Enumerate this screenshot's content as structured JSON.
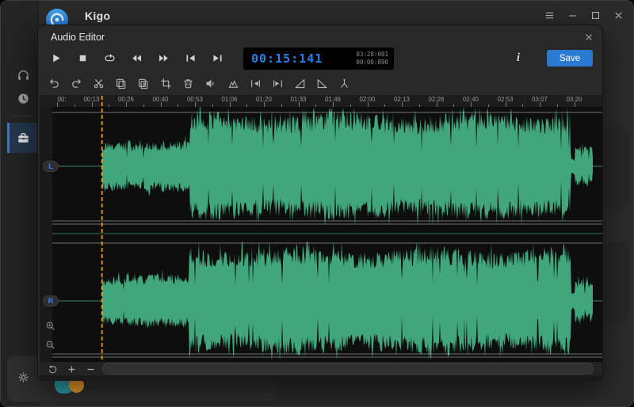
{
  "window": {
    "title": "Kigo",
    "controls": [
      {
        "icon": "menu-icon"
      },
      {
        "icon": "minimize-icon"
      },
      {
        "icon": "maximize-icon"
      },
      {
        "icon": "close-icon"
      }
    ]
  },
  "sidebar": {
    "items": [
      {
        "id": "audio",
        "icon": "headphones-icon",
        "active": false
      },
      {
        "id": "history",
        "icon": "history-icon",
        "active": false
      },
      {
        "id": "toolbox",
        "icon": "toolbox-icon",
        "active": true
      }
    ],
    "settings_icon": "gear-icon"
  },
  "dialog": {
    "title": "Audio Editor",
    "close_icon": "close-icon",
    "transport": [
      {
        "id": "play",
        "icon": "play-icon"
      },
      {
        "id": "stop",
        "icon": "stop-icon"
      },
      {
        "id": "loop",
        "icon": "loop-icon"
      },
      {
        "id": "rewind",
        "icon": "rewind-icon"
      },
      {
        "id": "fast-forward",
        "icon": "fast-forward-icon"
      },
      {
        "id": "skip-start",
        "icon": "skip-start-icon"
      },
      {
        "id": "skip-end",
        "icon": "skip-end-icon"
      }
    ],
    "time_display": {
      "current": "00:15:141",
      "total": "03:28:001",
      "remaining": "00:00:890"
    },
    "info_label": "i",
    "save_label": "Save",
    "toolbar": [
      {
        "id": "undo",
        "icon": "undo-icon"
      },
      {
        "id": "redo",
        "icon": "redo-icon"
      },
      {
        "id": "cut",
        "icon": "cut-icon"
      },
      {
        "id": "copy",
        "icon": "copy-icon"
      },
      {
        "id": "paste",
        "icon": "paste-icon"
      },
      {
        "id": "crop",
        "icon": "crop-icon"
      },
      {
        "id": "delete",
        "icon": "trash-icon"
      },
      {
        "id": "volume",
        "icon": "volume-icon"
      },
      {
        "id": "levels",
        "icon": "levels-icon"
      },
      {
        "id": "marker-in",
        "icon": "marker-in-icon"
      },
      {
        "id": "marker-out",
        "icon": "marker-out-icon"
      },
      {
        "id": "fade-in",
        "icon": "fade-in-icon"
      },
      {
        "id": "fade-out",
        "icon": "fade-out-icon"
      },
      {
        "id": "split",
        "icon": "split-icon"
      }
    ],
    "ruler_labels": [
      "00:",
      "00:13",
      "00:26",
      "00:40",
      "00:53",
      "01:06",
      "01:20",
      "01:33",
      "01:46",
      "02:00",
      "02:13",
      "02:26",
      "02:40",
      "02:53",
      "03:07",
      "03:20"
    ],
    "channels": [
      {
        "label": "L"
      },
      {
        "label": "R"
      }
    ],
    "zoom_controls": [
      {
        "id": "zoom-in",
        "icon": "zoom-in-icon"
      },
      {
        "id": "zoom-out",
        "icon": "zoom-out-icon"
      }
    ],
    "bottom_controls": [
      {
        "id": "reset-zoom",
        "icon": "reset-icon"
      },
      {
        "id": "increase",
        "icon": "plus-icon"
      },
      {
        "id": "decrease",
        "icon": "minus-icon"
      }
    ]
  },
  "waveform": {
    "duration_s": 208,
    "audio_start_s": 17.4,
    "segments": [
      {
        "from_s": 17.4,
        "to_s": 51.2,
        "amplitude": 0.45,
        "roughness": 0.35
      },
      {
        "from_s": 51.2,
        "to_s": 198.8,
        "amplitude": 0.97,
        "roughness": 0.3
      },
      {
        "from_s": 198.8,
        "to_s": 200.4,
        "amplitude": 0.16,
        "roughness": 0.3
      },
      {
        "from_s": 200.4,
        "to_s": 207.4,
        "amplitude": 0.34,
        "roughness": 0.4
      }
    ]
  },
  "colors": {
    "waveform": "#41a67c",
    "centerline": "#3c8a67",
    "bounds_line": "rgba(215,215,215,0.5)",
    "playhead": "#f2a33c",
    "accent": "#2b7ad2",
    "time_text": "#2a80e8",
    "channel_label": "#3b82f6",
    "sidebar_accent": "#2e7cd6"
  }
}
